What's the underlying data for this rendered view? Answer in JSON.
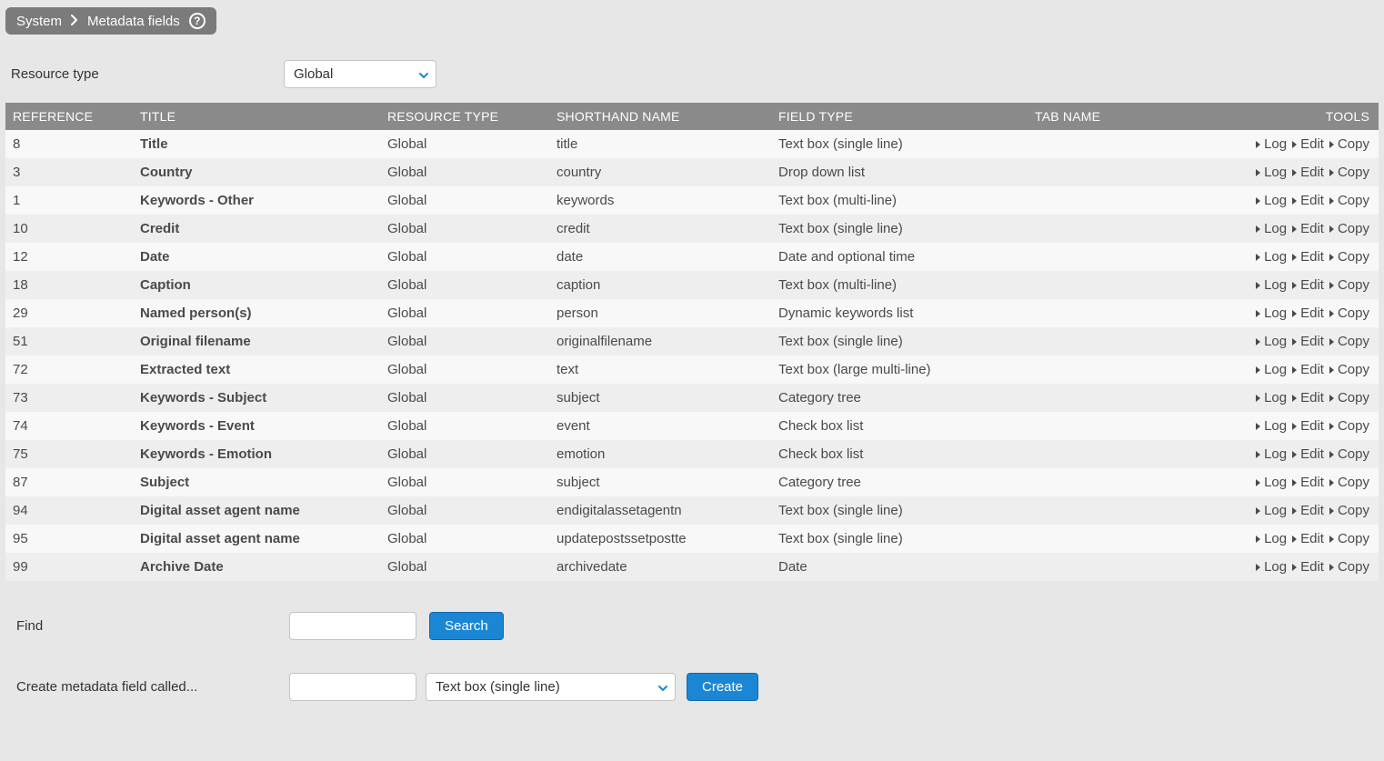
{
  "breadcrumb": {
    "system": "System",
    "page": "Metadata fields",
    "help": "?"
  },
  "filter": {
    "label": "Resource type",
    "value": "Global"
  },
  "columns": {
    "reference": "REFERENCE",
    "title": "TITLE",
    "resource_type": "RESOURCE TYPE",
    "shorthand": "SHORTHAND NAME",
    "field_type": "FIELD TYPE",
    "tab_name": "TAB NAME",
    "tools": "TOOLS"
  },
  "tool_labels": {
    "log": "Log",
    "edit": "Edit",
    "copy": "Copy"
  },
  "rows": [
    {
      "ref": "8",
      "title": "Title",
      "rtype": "Global",
      "short": "title",
      "ftype": "Text box (single line)",
      "tab": ""
    },
    {
      "ref": "3",
      "title": "Country",
      "rtype": "Global",
      "short": "country",
      "ftype": "Drop down list",
      "tab": ""
    },
    {
      "ref": "1",
      "title": "Keywords - Other",
      "rtype": "Global",
      "short": "keywords",
      "ftype": "Text box (multi-line)",
      "tab": ""
    },
    {
      "ref": "10",
      "title": "Credit",
      "rtype": "Global",
      "short": "credit",
      "ftype": "Text box (single line)",
      "tab": ""
    },
    {
      "ref": "12",
      "title": "Date",
      "rtype": "Global",
      "short": "date",
      "ftype": "Date and optional time",
      "tab": ""
    },
    {
      "ref": "18",
      "title": "Caption",
      "rtype": "Global",
      "short": "caption",
      "ftype": "Text box (multi-line)",
      "tab": ""
    },
    {
      "ref": "29",
      "title": "Named person(s)",
      "rtype": "Global",
      "short": "person",
      "ftype": "Dynamic keywords list",
      "tab": ""
    },
    {
      "ref": "51",
      "title": "Original filename",
      "rtype": "Global",
      "short": "originalfilename",
      "ftype": "Text box (single line)",
      "tab": ""
    },
    {
      "ref": "72",
      "title": "Extracted text",
      "rtype": "Global",
      "short": "text",
      "ftype": "Text box (large multi-line)",
      "tab": ""
    },
    {
      "ref": "73",
      "title": "Keywords - Subject",
      "rtype": "Global",
      "short": "subject",
      "ftype": "Category tree",
      "tab": ""
    },
    {
      "ref": "74",
      "title": "Keywords - Event",
      "rtype": "Global",
      "short": "event",
      "ftype": "Check box list",
      "tab": ""
    },
    {
      "ref": "75",
      "title": "Keywords - Emotion",
      "rtype": "Global",
      "short": "emotion",
      "ftype": "Check box list",
      "tab": ""
    },
    {
      "ref": "87",
      "title": "Subject",
      "rtype": "Global",
      "short": "subject",
      "ftype": "Category tree",
      "tab": ""
    },
    {
      "ref": "94",
      "title": "Digital asset agent name",
      "rtype": "Global",
      "short": "endigitalassetagentn",
      "ftype": "Text box (single line)",
      "tab": ""
    },
    {
      "ref": "95",
      "title": "Digital asset agent name",
      "rtype": "Global",
      "short": "updatepostssetpostte",
      "ftype": "Text box (single line)",
      "tab": ""
    },
    {
      "ref": "99",
      "title": "Archive Date",
      "rtype": "Global",
      "short": "archivedate",
      "ftype": "Date",
      "tab": ""
    }
  ],
  "find": {
    "label": "Find",
    "button": "Search"
  },
  "create": {
    "label": "Create metadata field called...",
    "type_value": "Text box (single line)",
    "button": "Create"
  }
}
